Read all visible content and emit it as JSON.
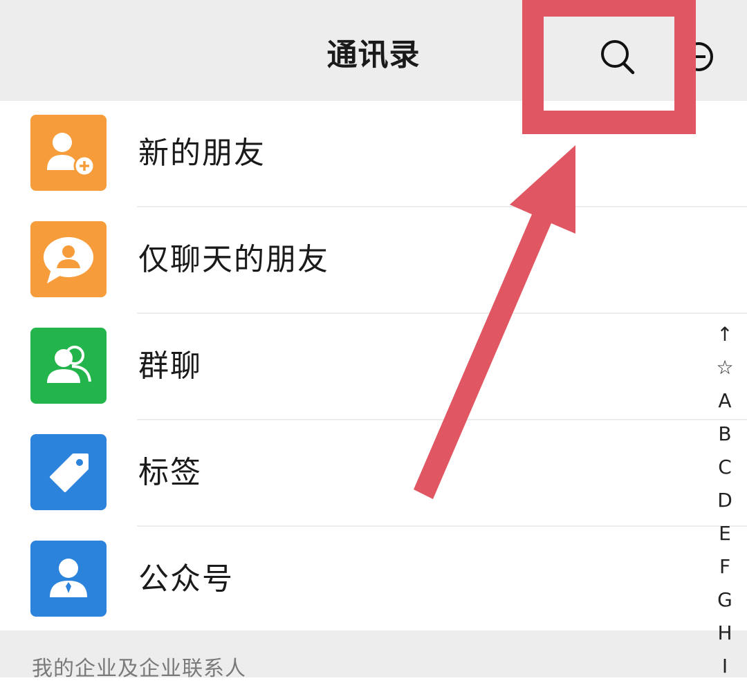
{
  "header": {
    "title": "通讯录",
    "search_icon": "search-icon",
    "add_icon": "add-circle-icon"
  },
  "menu": [
    {
      "label": "新的朋友",
      "icon": "new-friend-icon",
      "color": "#F79C3A"
    },
    {
      "label": "仅聊天的朋友",
      "icon": "chat-only-friend-icon",
      "color": "#F79C3A"
    },
    {
      "label": "群聊",
      "icon": "group-chat-icon",
      "color": "#23B44B"
    },
    {
      "label": "标签",
      "icon": "tag-icon",
      "color": "#2B83DC"
    },
    {
      "label": "公众号",
      "icon": "official-account-icon",
      "color": "#2B83DC"
    }
  ],
  "section": {
    "label": "我的企业及企业联系人"
  },
  "index_bar": [
    "↑",
    "☆",
    "A",
    "B",
    "C",
    "D",
    "E",
    "F",
    "G",
    "H",
    "I"
  ],
  "annotation": {
    "color": "#E05663",
    "highlight": "search-icon"
  }
}
